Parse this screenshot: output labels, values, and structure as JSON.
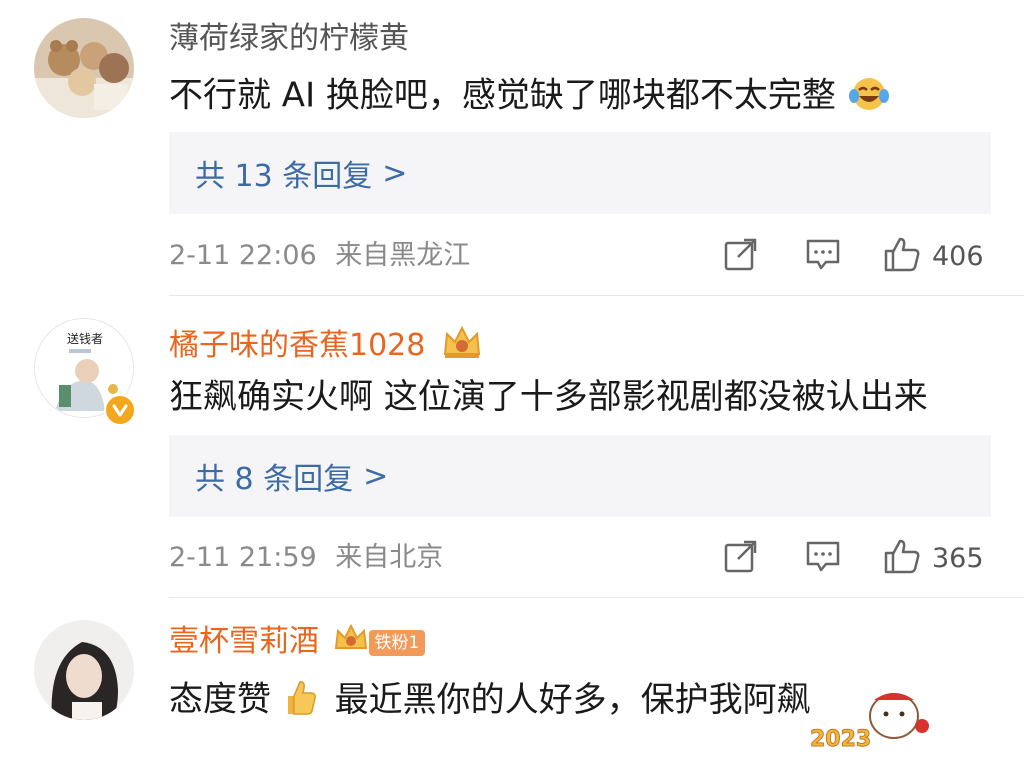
{
  "colors": {
    "username_normal": "#555555",
    "username_vip": "#e8661e",
    "reply_link": "#3d6ba6",
    "meta": "#8a8a8a",
    "reply_bg": "#f5f5f7"
  },
  "comments": [
    {
      "username": "薄荷绿家的柠檬黄",
      "text": "不行就 AI 换脸吧，感觉缺了哪块都不太完整",
      "text_emoji": "laughing-tears-emoji",
      "replies_label": "共 13 条回复",
      "replies_arrow": ">",
      "timestamp": "2-11 22:06",
      "location": "来自黑龙江",
      "likes": "406"
    },
    {
      "username": "橘子味的香蕉1028",
      "avatar_label": "送钱者",
      "name_badge": "crown-badge",
      "text": "狂飙确实火啊 这位演了十多部影视剧都没被认出来",
      "replies_label": "共 8 条回复",
      "replies_arrow": ">",
      "timestamp": "2-11 21:59",
      "location": "来自北京",
      "likes": "365"
    },
    {
      "username": "壹杯雪莉酒",
      "name_badge": "crown-badge",
      "fan_badge": "铁粉1",
      "text_before": "态度赞",
      "text_emoji": "thumbs-up-emoji",
      "text_after": "最近黑你的人好多，保护我阿飙",
      "sticker_label": "2023"
    }
  ]
}
